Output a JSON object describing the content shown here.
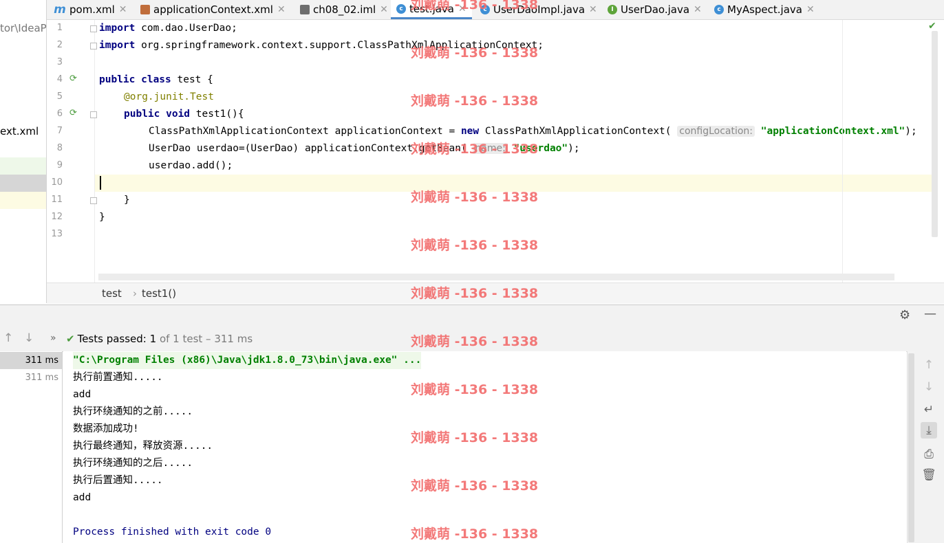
{
  "project_panel": {
    "path_fragment": "tor\\IdeaP",
    "file_fragment": "ext.xml"
  },
  "tabs": [
    {
      "label": "pom.xml",
      "icon": "maven-icon",
      "active": false
    },
    {
      "label": "applicationContext.xml",
      "icon": "xml-file-icon",
      "active": false
    },
    {
      "label": "ch08_02.iml",
      "icon": "module-file-icon",
      "active": false
    },
    {
      "label": "test.java",
      "icon": "class-icon",
      "active": true
    },
    {
      "label": "UserDaoImpl.java",
      "icon": "class-icon",
      "active": false
    },
    {
      "label": "UserDao.java",
      "icon": "interface-icon",
      "active": false
    },
    {
      "label": "MyAspect.java",
      "icon": "class-icon",
      "active": false
    }
  ],
  "icon_letters": {
    "class": "c",
    "interface": "I",
    "maven": "m"
  },
  "line_numbers": [
    "1",
    "2",
    "3",
    "4",
    "5",
    "6",
    "7",
    "8",
    "9",
    "10",
    "11",
    "12",
    "13"
  ],
  "code": {
    "l1_kw": "import",
    "l1_rest": " com.dao.UserDao;",
    "l2_kw": "import",
    "l2_rest": " org.springframework.context.support.ClassPathXmlApplicationContext;",
    "l4_kw": "public class",
    "l4_rest": " test {",
    "l5_ann": "@org.junit.",
    "l5_ann2": "Test",
    "l6_kw": "public void",
    "l6_rest": " test1(){",
    "l7_pre": "ClassPathXmlApplicationContext applicationContext = ",
    "l7_kw": "new",
    "l7_mid": " ClassPathXmlApplicationContext( ",
    "l7_hint": "configLocation:",
    "l7_str": "\"applicationContext.xml\"",
    "l7_end": ");",
    "l8_pre": "UserDao userdao=(UserDao) applicationContext.getBean( ",
    "l8_hint": "name:",
    "l8_str": "\"userdao\"",
    "l8_end": ");",
    "l9": "userdao.add();",
    "l11": "}",
    "l12": "}"
  },
  "breadcrumb": {
    "class_name": "test",
    "separator": "›",
    "method_name": "test1()"
  },
  "run": {
    "status_prefix": "Tests passed: ",
    "passed_count": "1",
    "status_suffix": " of 1 test – 311 ms",
    "times": [
      "311 ms",
      "311 ms"
    ]
  },
  "console_lines": [
    "\"C:\\Program Files (x86)\\Java\\jdk1.8.0_73\\bin\\java.exe\" ...",
    "执行前置通知.....",
    "add",
    "执行环绕通知的之前.....",
    "数据添加成功!",
    "执行最终通知，释放资源.....",
    "执行环绕通知的之后.....",
    "执行后置通知.....",
    "add",
    "",
    "Process finished with exit code 0"
  ],
  "watermark": "刘戴萌 -136 - 1338",
  "colors": {
    "keyword": "#000080",
    "string": "#008000",
    "annotation": "#808000",
    "pass_green": "#4a9b3c",
    "tab_active_underline": "#4a86c8",
    "watermark": "#f26b6b"
  }
}
